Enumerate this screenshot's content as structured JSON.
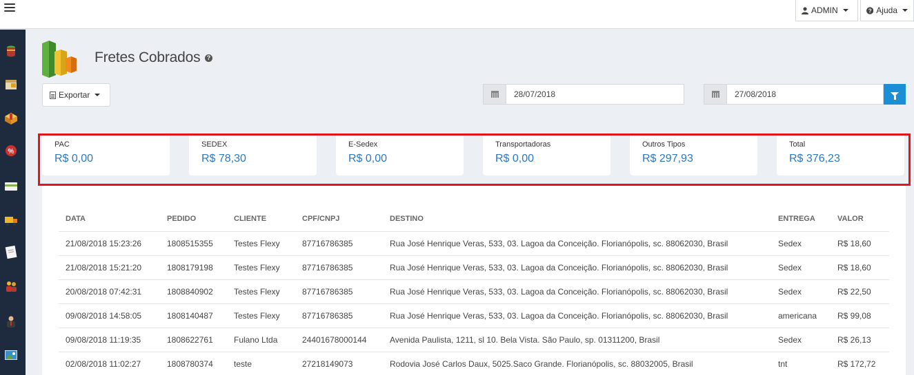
{
  "topbar": {
    "admin_label": "ADMIN",
    "help_label": "Ajuda"
  },
  "sidebar": {
    "items": [
      {
        "icon": "database-icon",
        "color": "#c0392b"
      },
      {
        "icon": "box-icon",
        "color": "#d9a441"
      },
      {
        "icon": "package-icon",
        "color": "#e0a027"
      },
      {
        "icon": "percent-icon",
        "color": "#d0312d"
      },
      {
        "icon": "card-icon",
        "color": "#88b04b"
      },
      {
        "icon": "truck-icon",
        "color": "#f0b429"
      },
      {
        "icon": "document-icon",
        "color": "#e8e8e8"
      },
      {
        "icon": "users-icon",
        "color": "#d35400"
      },
      {
        "icon": "user-icon",
        "color": "#6b4c3b"
      },
      {
        "icon": "image-icon",
        "color": "#3a8fd1"
      }
    ]
  },
  "page": {
    "title": "Fretes Cobrados",
    "export_label": "Exportar",
    "date_from": "28/07/2018",
    "date_to": "27/08/2018"
  },
  "summary": [
    {
      "label": "PAC",
      "value": "R$ 0,00"
    },
    {
      "label": "SEDEX",
      "value": "R$ 78,30"
    },
    {
      "label": "E-Sedex",
      "value": "R$ 0,00"
    },
    {
      "label": "Transportadoras",
      "value": "R$ 0,00"
    },
    {
      "label": "Outros Tipos",
      "value": "R$ 297,93"
    },
    {
      "label": "Total",
      "value": "R$ 376,23"
    }
  ],
  "table": {
    "headers": [
      "DATA",
      "PEDIDO",
      "CLIENTE",
      "CPF/CNPJ",
      "DESTINO",
      "ENTREGA",
      "VALOR"
    ],
    "rows": [
      [
        "21/08/2018 15:23:26",
        "1808515355",
        "Testes Flexy",
        "87716786385",
        "Rua José Henrique Veras, 533, 03. Lagoa da Conceição. Florianópolis, sc. 88062030, Brasil",
        "Sedex",
        "R$ 18,60"
      ],
      [
        "21/08/2018 15:21:20",
        "1808179198",
        "Testes Flexy",
        "87716786385",
        "Rua José Henrique Veras, 533, 03. Lagoa da Conceição. Florianópolis, sc. 88062030, Brasil",
        "Sedex",
        "R$ 18,60"
      ],
      [
        "20/08/2018 07:42:31",
        "1808840902",
        "Testes Flexy",
        "87716786385",
        "Rua José Henrique Veras, 533, 03. Lagoa da Conceição. Florianópolis, sc. 88062030, Brasil",
        "Sedex",
        "R$ 22,50"
      ],
      [
        "09/08/2018 14:58:05",
        "1808140487",
        "Testes Flexy",
        "87716786385",
        "Rua José Henrique Veras, 533, 03. Lagoa da Conceição. Florianópolis, sc. 88062030, Brasil",
        "americana",
        "R$ 99,08"
      ],
      [
        "09/08/2018 11:19:35",
        "1808622761",
        "Fulano Ltda",
        "24401678000144",
        "Avenida Paulista, 1211, sl 10. Bela Vista. São Paulo, sp. 01311200, Brasil",
        "Sedex",
        "R$ 26,13"
      ],
      [
        "02/08/2018 11:02:27",
        "1808780374",
        "teste",
        "27218149073",
        "Rodovia José Carlos Daux, 5025.Saco Grande. Florianópolis, sc. 88032005, Brasil",
        "tnt",
        "R$ 172,72"
      ]
    ]
  }
}
